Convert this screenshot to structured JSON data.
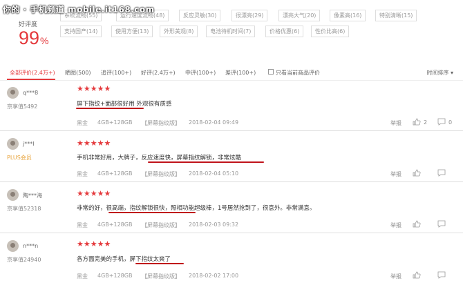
{
  "watermark": "你的 · 手机频道 mobile.it168.com",
  "summary": {
    "rate_label": "好评度",
    "rate_value": "99",
    "rate_unit": "%",
    "tags": [
      {
        "label": "系统流畅(55)"
      },
      {
        "label": "运行速度流畅(48)"
      },
      {
        "label": "反应灵敏(30)"
      },
      {
        "label": "很漂亮(29)"
      },
      {
        "label": "漂亮大气(20)"
      },
      {
        "label": "像素高(16)"
      },
      {
        "label": "特别清晰(15)"
      },
      {
        "label": "支持国产(14)"
      },
      {
        "label": "使用方便(13)"
      },
      {
        "label": "外形美观(8)"
      },
      {
        "label": "电池待机时间(7)"
      },
      {
        "label": "价格优惠(6)"
      },
      {
        "label": "性价比高(6)"
      }
    ]
  },
  "filters": {
    "all": "全部评价(2.4万+)",
    "photo": "晒图(500)",
    "followup": "追评(100+)",
    "good": "好评(2.4万+)",
    "medium": "中评(100+)",
    "bad": "差评(100+)",
    "current_only": "只看当前商品评价",
    "sort": "时间排序"
  },
  "reviews": [
    {
      "user": "q***8",
      "level": "京享值5492",
      "stars": "★★★★★",
      "content": "屏下指纹+面部很好用 外观很有质感",
      "color": "黑金",
      "spec": "4GB+128GB",
      "version": "【屏幕指纹版】",
      "date": "2018-02-04 09:49",
      "report": "举报",
      "likes": "2",
      "replies": "0"
    },
    {
      "user": "j***l",
      "level": "PLUS会员",
      "stars": "★★★★★",
      "content": "手机非常好用，大牌子，反应速度快，屏幕指纹解锁，非常炫酷",
      "color": "黑金",
      "spec": "4GB+128GB",
      "version": "【屏幕指纹版】",
      "date": "2018-02-04 05:10",
      "report": "举报",
      "likes": "",
      "replies": ""
    },
    {
      "user": "陶***海",
      "level": "京享值52318",
      "stars": "★★★★★",
      "content": "非常的好，很高端，指纹解锁很快，照相功能超级棒，1号居然抢到了，很意外。非常满意。",
      "color": "黑金",
      "spec": "4GB+128GB",
      "version": "【屏幕指纹版】",
      "date": "2018-02-03 09:32",
      "report": "举报",
      "likes": "",
      "replies": ""
    },
    {
      "user": "n***n",
      "level": "京享值24940",
      "stars": "★★★★★",
      "content": "各方面完美的手机，屏下指纹太爽了",
      "color": "黑金",
      "spec": "4GB+128GB",
      "version": "【屏幕指纹版】",
      "date": "2018-02-02 17:00",
      "report": "举报",
      "likes": "",
      "replies": ""
    }
  ],
  "colors": {
    "accent": "#e4393c",
    "underline": "#c0121a"
  }
}
